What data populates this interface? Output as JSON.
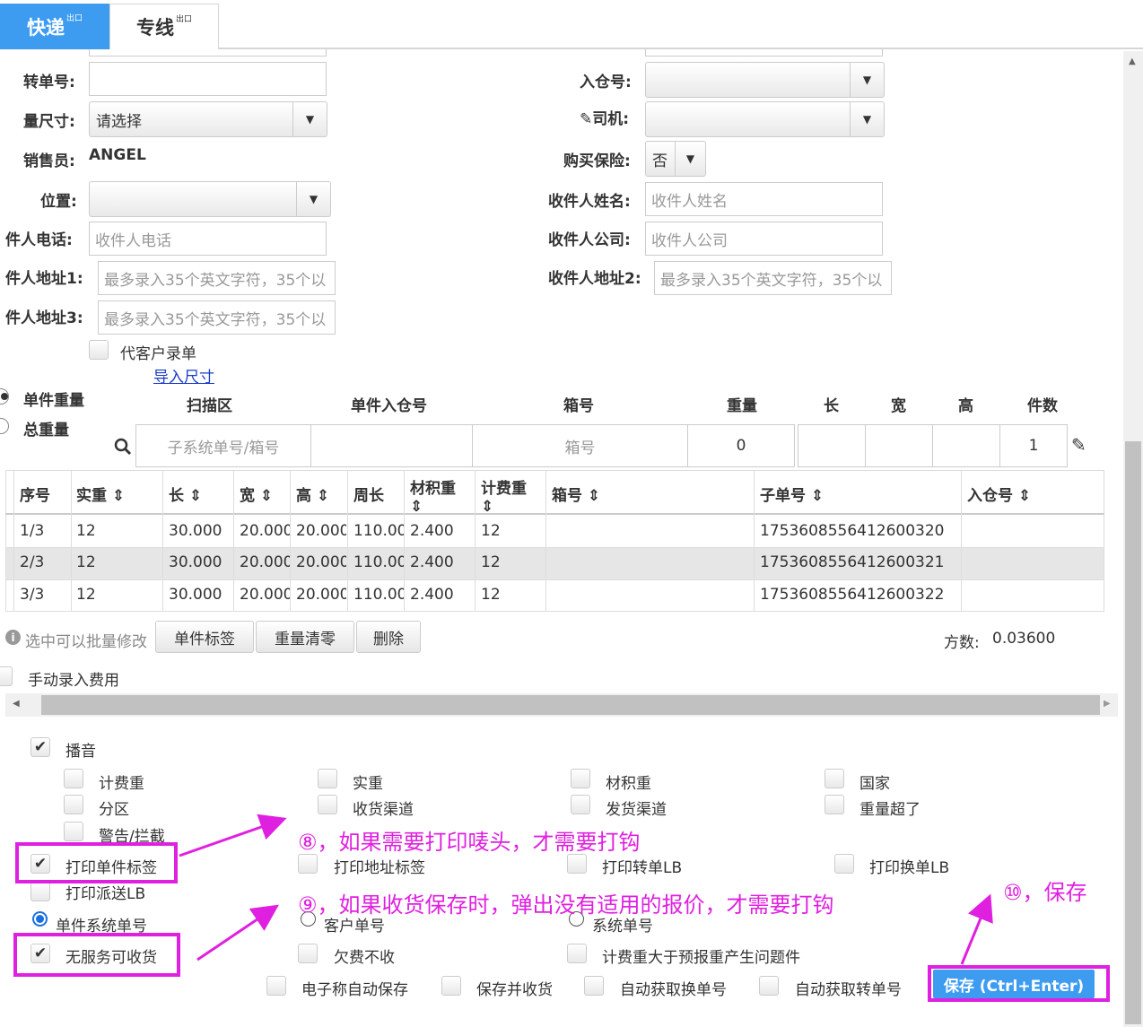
{
  "tabs": [
    {
      "label": "快递",
      "badge": "出口"
    },
    {
      "label": "专线",
      "badge": "出口"
    }
  ],
  "form": {
    "transfer_no_label": "转单号:",
    "size_label": "量尺寸:",
    "size_value": "请选择",
    "sales_label": "销售员:",
    "sales_value": "ANGEL",
    "position_label": "位置:",
    "sender_phone_label": "件人电话:",
    "sender_phone_ph": "收件人电话",
    "sender_addr1_label": "件人地址1:",
    "addr_ph": "最多录入35个英文字符，35个以",
    "sender_addr3_label": "件人地址3:",
    "proxy_label": "代客户录单",
    "import_size_link": "导入尺寸",
    "warehouse_no_label": "入仓号:",
    "driver_label": "司机:",
    "insurance_label": "购买保险:",
    "insurance_value": "否",
    "recv_name_label": "收件人姓名:",
    "recv_name_ph": "收件人姓名",
    "recv_company_label": "收件人公司:",
    "recv_company_ph": "收件人公司",
    "recv_addr2_label": "收件人地址2:"
  },
  "weight_mode": {
    "single": "单件重量",
    "total": "总重量"
  },
  "scan_headers": [
    "扫描区",
    "单件入仓号",
    "箱号",
    "重量",
    "长",
    "宽",
    "高",
    "件数"
  ],
  "scan_inputs": {
    "scan_ph": "子系统单号/箱号",
    "box_ph": "箱号",
    "weight": "0",
    "count": "1"
  },
  "table": {
    "headers": [
      "序号",
      "实重",
      "长",
      "宽",
      "高",
      "周长",
      "材积重",
      "计费重",
      "箱号",
      "子单号",
      "入仓号"
    ],
    "rows": [
      [
        "1/3",
        "12",
        "30.000",
        "20.000",
        "20.000",
        "110.000",
        "2.400",
        "12",
        "",
        "1753608556412600320",
        ""
      ],
      [
        "2/3",
        "12",
        "30.000",
        "20.000",
        "20.000",
        "110.000",
        "2.400",
        "12",
        "",
        "1753608556412600321",
        ""
      ],
      [
        "3/3",
        "12",
        "30.000",
        "20.000",
        "20.000",
        "110.000",
        "2.400",
        "12",
        "",
        "1753608556412600322",
        ""
      ]
    ]
  },
  "batch": {
    "hint": "选中可以批量修改",
    "buttons": [
      "单件标签",
      "重量清零",
      "删除"
    ],
    "cubic_label": "方数:",
    "cubic_value": "0.03600"
  },
  "manual_fee": "手动录入费用",
  "broadcast": {
    "label": "播音",
    "items": [
      "计费重",
      "实重",
      "材积重",
      "国家",
      "分区",
      "收货渠道",
      "发货渠道",
      "重量超了",
      "警告/拦截"
    ]
  },
  "print": {
    "single_label": "打印单件标签",
    "address_label": "打印地址标签",
    "transfer_lb": "打印转单LB",
    "change_lb": "打印换单LB",
    "dispatch_lb": "打印派送LB"
  },
  "radios": {
    "single_sys": "单件系统单号",
    "customer": "客户单号",
    "system": "系统单号"
  },
  "misc": {
    "no_service": "无服务可收货",
    "arrears": "欠费不收",
    "over_weight": "计费重大于预报重产生问题件",
    "auto_save": "电子称自动保存",
    "save_receive": "保存并收货",
    "auto_change": "自动获取换单号",
    "auto_transfer": "自动获取转单号"
  },
  "save_button": "保存 (Ctrl+Enter)",
  "annotations": {
    "a8": "⑧，如果需要打印唛头，才需要打钩",
    "a9": "⑨，如果收货保存时，弹出没有适用的报价，才需要打钩",
    "a10": "⑩，保存"
  },
  "colors": {
    "tab_active": "#3d9cf0",
    "save": "#3d9cf0",
    "annotation": "#e020e0"
  }
}
